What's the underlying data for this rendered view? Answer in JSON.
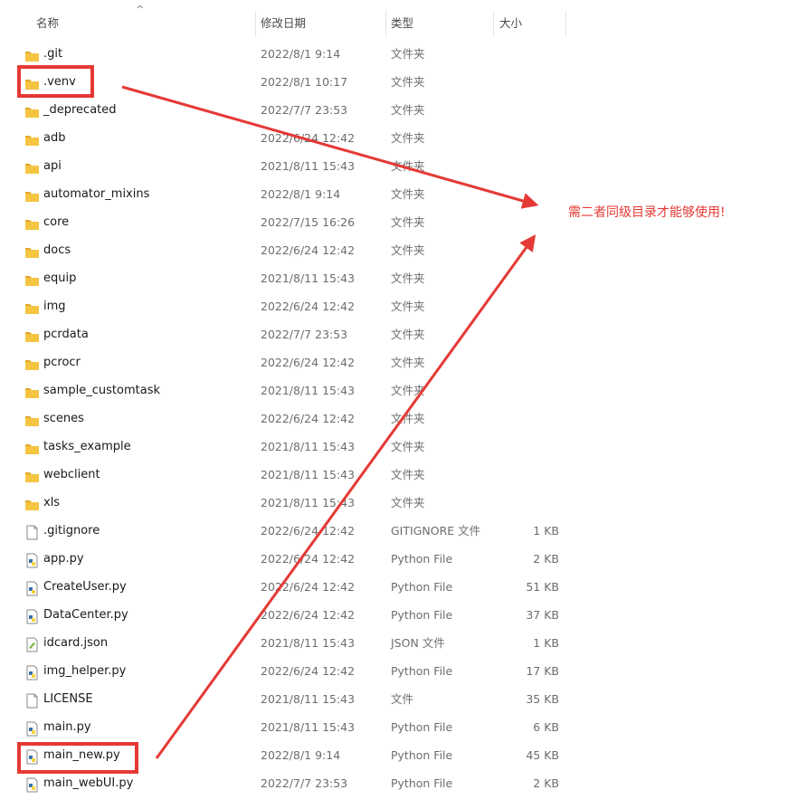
{
  "header": {
    "col_name": "名称",
    "col_date": "修改日期",
    "col_type": "类型",
    "col_size": "大小",
    "sort_icon": "sort-ascending-icon"
  },
  "files": [
    {
      "name": ".git",
      "date": "2022/8/1 9:14",
      "type": "文件夹",
      "size": "",
      "icon": "folder-icon"
    },
    {
      "name": ".venv",
      "date": "2022/8/1 10:17",
      "type": "文件夹",
      "size": "",
      "icon": "folder-icon"
    },
    {
      "name": "_deprecated",
      "date": "2022/7/7 23:53",
      "type": "文件夹",
      "size": "",
      "icon": "folder-icon"
    },
    {
      "name": "adb",
      "date": "2022/6/24 12:42",
      "type": "文件夹",
      "size": "",
      "icon": "folder-icon"
    },
    {
      "name": "api",
      "date": "2021/8/11 15:43",
      "type": "文件夹",
      "size": "",
      "icon": "folder-icon"
    },
    {
      "name": "automator_mixins",
      "date": "2022/8/1 9:14",
      "type": "文件夹",
      "size": "",
      "icon": "folder-icon"
    },
    {
      "name": "core",
      "date": "2022/7/15 16:26",
      "type": "文件夹",
      "size": "",
      "icon": "folder-icon"
    },
    {
      "name": "docs",
      "date": "2022/6/24 12:42",
      "type": "文件夹",
      "size": "",
      "icon": "folder-icon"
    },
    {
      "name": "equip",
      "date": "2021/8/11 15:43",
      "type": "文件夹",
      "size": "",
      "icon": "folder-icon"
    },
    {
      "name": "img",
      "date": "2022/6/24 12:42",
      "type": "文件夹",
      "size": "",
      "icon": "folder-icon"
    },
    {
      "name": "pcrdata",
      "date": "2022/7/7 23:53",
      "type": "文件夹",
      "size": "",
      "icon": "folder-icon"
    },
    {
      "name": "pcrocr",
      "date": "2022/6/24 12:42",
      "type": "文件夹",
      "size": "",
      "icon": "folder-icon"
    },
    {
      "name": "sample_customtask",
      "date": "2021/8/11 15:43",
      "type": "文件夹",
      "size": "",
      "icon": "folder-icon"
    },
    {
      "name": "scenes",
      "date": "2022/6/24 12:42",
      "type": "文件夹",
      "size": "",
      "icon": "folder-icon"
    },
    {
      "name": "tasks_example",
      "date": "2021/8/11 15:43",
      "type": "文件夹",
      "size": "",
      "icon": "folder-icon"
    },
    {
      "name": "webclient",
      "date": "2021/8/11 15:43",
      "type": "文件夹",
      "size": "",
      "icon": "folder-icon"
    },
    {
      "name": "xls",
      "date": "2021/8/11 15:43",
      "type": "文件夹",
      "size": "",
      "icon": "folder-icon"
    },
    {
      "name": ".gitignore",
      "date": "2022/6/24 12:42",
      "type": "GITIGNORE 文件",
      "size": "1 KB",
      "icon": "file-icon"
    },
    {
      "name": "app.py",
      "date": "2022/6/24 12:42",
      "type": "Python File",
      "size": "2 KB",
      "icon": "python-file-icon"
    },
    {
      "name": "CreateUser.py",
      "date": "2022/6/24 12:42",
      "type": "Python File",
      "size": "51 KB",
      "icon": "python-file-icon"
    },
    {
      "name": "DataCenter.py",
      "date": "2022/6/24 12:42",
      "type": "Python File",
      "size": "37 KB",
      "icon": "python-file-icon"
    },
    {
      "name": "idcard.json",
      "date": "2021/8/11 15:43",
      "type": "JSON 文件",
      "size": "1 KB",
      "icon": "json-file-icon"
    },
    {
      "name": "img_helper.py",
      "date": "2022/6/24 12:42",
      "type": "Python File",
      "size": "17 KB",
      "icon": "python-file-icon"
    },
    {
      "name": "LICENSE",
      "date": "2021/8/11 15:43",
      "type": "文件",
      "size": "35 KB",
      "icon": "file-icon"
    },
    {
      "name": "main.py",
      "date": "2021/8/11 15:43",
      "type": "Python File",
      "size": "6 KB",
      "icon": "python-file-icon"
    },
    {
      "name": "main_new.py",
      "date": "2022/8/1 9:14",
      "type": "Python File",
      "size": "45 KB",
      "icon": "python-file-icon"
    },
    {
      "name": "main_webUI.py",
      "date": "2022/7/7 23:53",
      "type": "Python File",
      "size": "2 KB",
      "icon": "python-file-icon"
    }
  ],
  "annotation": {
    "note": "需二者同级目录才能够使用!",
    "color": "#e53935"
  },
  "colors": {
    "folder": "#f5c542",
    "folder_tab": "#e0a92a",
    "python_blue": "#3572a5",
    "python_yellow": "#f7d144"
  }
}
